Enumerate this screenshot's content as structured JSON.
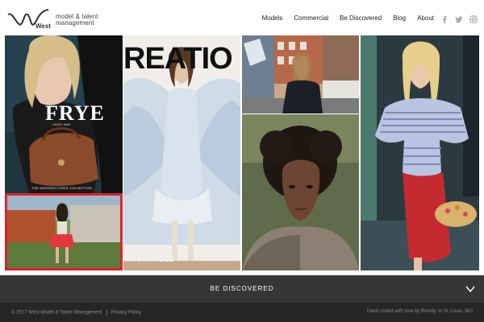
{
  "brand": {
    "logo_word": "West",
    "tagline_line1": "model & talent",
    "tagline_line2": "management"
  },
  "nav": {
    "items": [
      "Models",
      "Commercial",
      "Be Discovered",
      "Blog",
      "About"
    ]
  },
  "social": {
    "icons": [
      "facebook-icon",
      "twitter-icon",
      "instagram-icon"
    ]
  },
  "tiles": {
    "frye_title": "FRYE",
    "frye_sub": "SINCE 1863",
    "frye_collection": "THE MODERN ICONS COLLECTION",
    "creation_word": "REATIO",
    "editorial_line1": "TORIAL",
    "editorial_line2": "ATIONMAGES"
  },
  "banner": {
    "label": "BE DISCOVERED"
  },
  "footer": {
    "copyright": "© 2017 West Model & Talent Management",
    "privacy": "Privacy Policy",
    "credit": "Hand coded with love by Brevity, in St. Louis, MO"
  },
  "colors": {
    "accent_red": "#e0222b",
    "banner_bg": "#363636",
    "footer_bg": "#262626"
  }
}
